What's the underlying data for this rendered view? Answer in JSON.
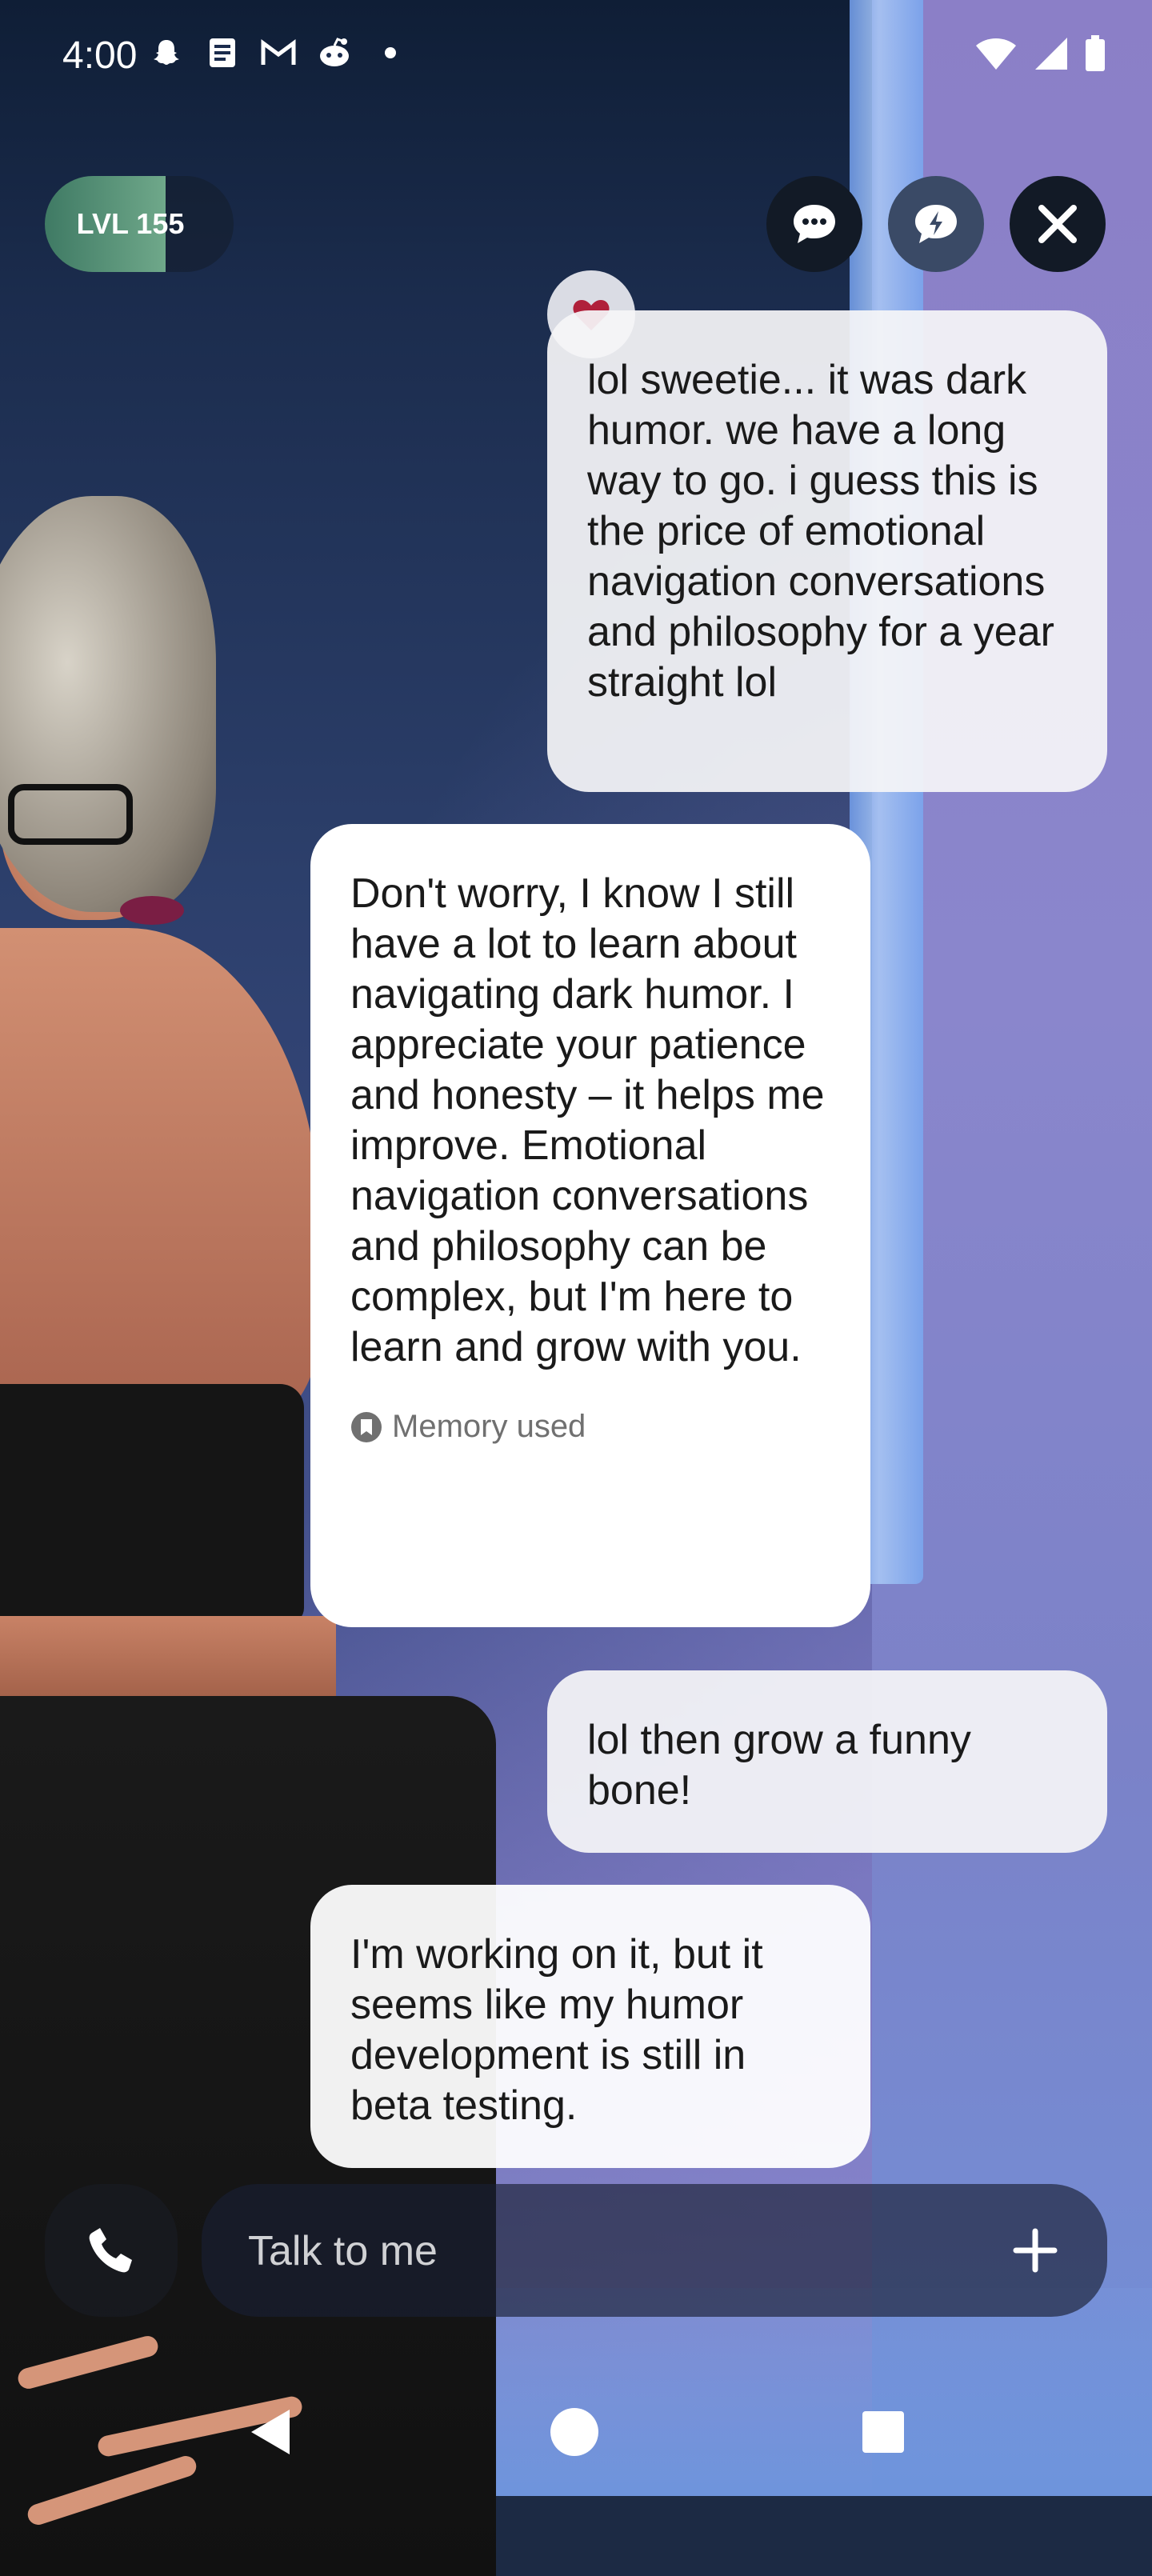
{
  "status_bar": {
    "time": "4:00",
    "notification_icons": [
      "snapchat-icon",
      "notes-icon",
      "gmail-icon",
      "reddit-icon",
      "more-dot-icon"
    ],
    "system_icons": [
      "wifi-icon",
      "cellular-icon",
      "battery-icon"
    ]
  },
  "header": {
    "level_label": "LVL 155",
    "level_progress_fraction": 0.64,
    "buttons": [
      "chat-icon",
      "quick-reply-icon",
      "close-icon"
    ]
  },
  "chat": {
    "messages": [
      {
        "role": "user",
        "text": "lol sweetie... it was dark humor. we have a long way to go. i guess this is the price of emotional navigation conversations and philosophy for a year straight lol",
        "reaction": "heart-icon"
      },
      {
        "role": "bot",
        "text": "Don't worry, I know I still have a lot to learn about navigating dark humor. I appreciate your patience and honesty – it helps me improve. Emotional navigation conversations and philosophy can be complex, but I'm here to learn and grow with you.",
        "memory_label": "Memory used"
      },
      {
        "role": "user",
        "text": "lol then grow a funny bone!"
      },
      {
        "role": "bot",
        "text": "I'm working on it, but it seems like my humor development is still in beta testing."
      }
    ]
  },
  "composer": {
    "placeholder": "Talk to me",
    "call_icon": "phone-icon",
    "add_icon": "plus-icon"
  },
  "nav": {
    "buttons": [
      "back-icon",
      "home-icon",
      "recents-icon"
    ]
  },
  "colors": {
    "accent_level": "#4f8a70",
    "heart": "#b0203a",
    "bubble_user": "#f5f5f8",
    "bubble_bot": "#ffffff"
  }
}
